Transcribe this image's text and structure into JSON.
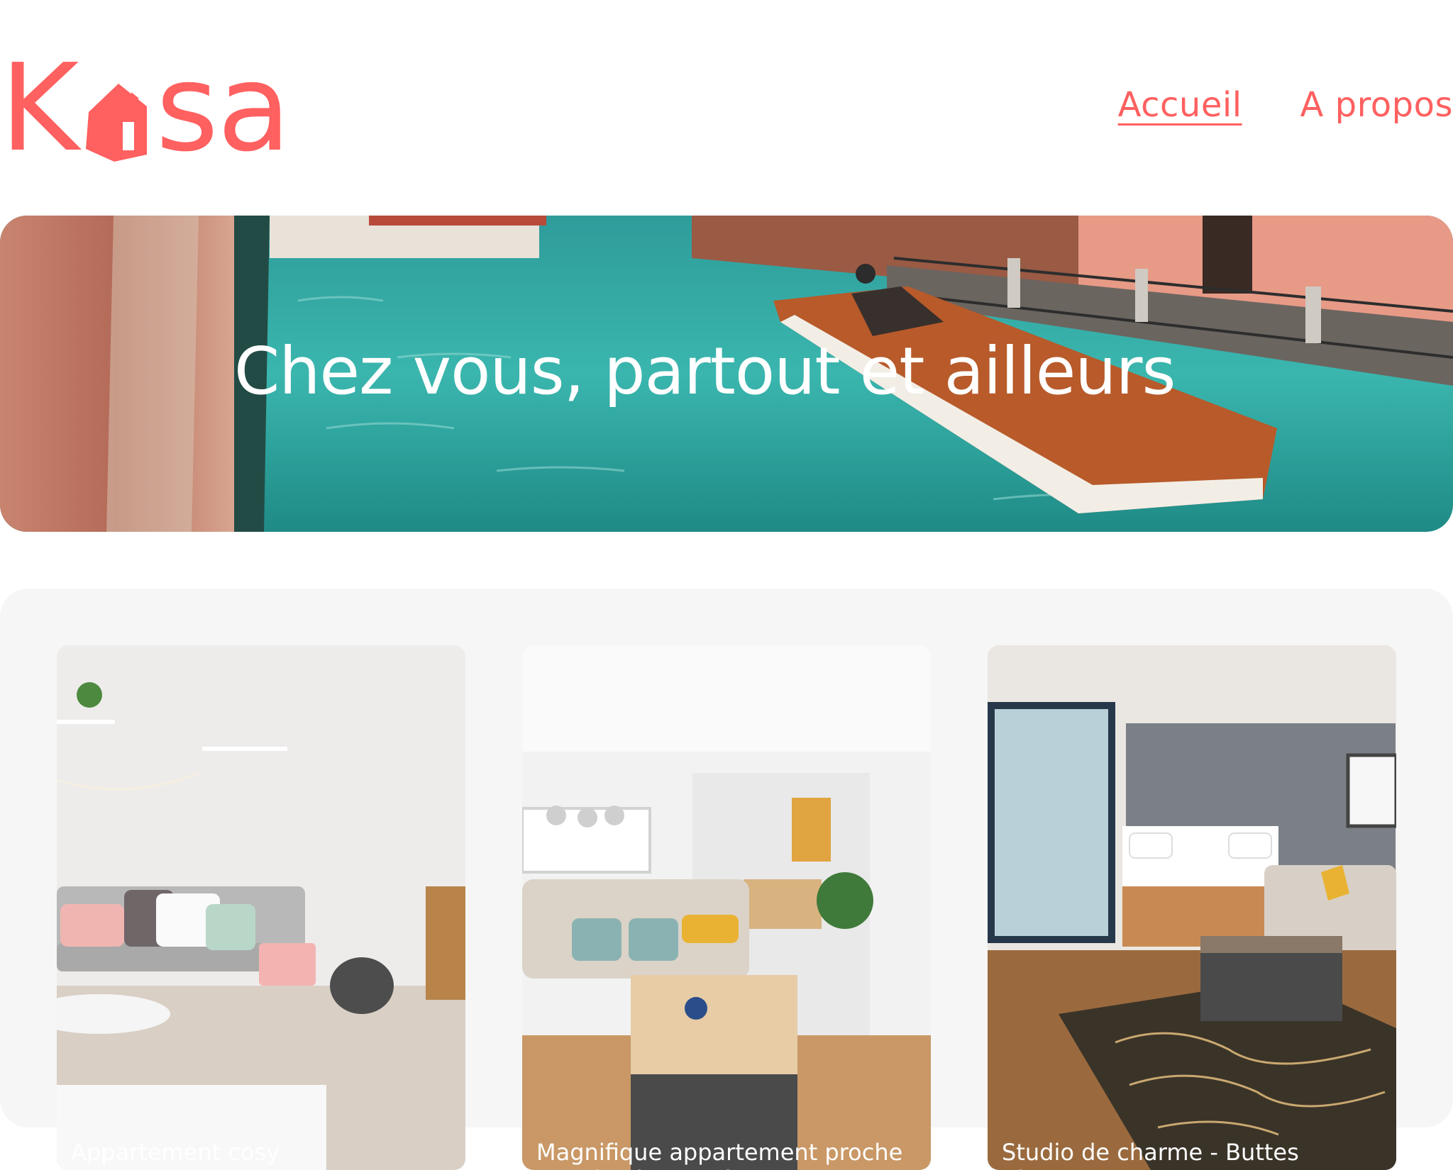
{
  "header": {
    "logo_text": "Kasa",
    "logo_first": "K",
    "logo_rest": "sa",
    "nav": [
      {
        "label": "Accueil",
        "active": true
      },
      {
        "label": "A propos",
        "active": false
      }
    ]
  },
  "banner": {
    "title": "Chez vous, partout et ailleurs"
  },
  "listings": [
    {
      "title": "Appartement cosy"
    },
    {
      "title": "Magnifique appartement proche Canal Saint Martin"
    },
    {
      "title": "Studio de charme - Buttes Chaumont"
    }
  ],
  "colors": {
    "brand": "#ff6060",
    "gallery_bg": "#f6f6f6",
    "text_on_image": "#ffffff"
  }
}
